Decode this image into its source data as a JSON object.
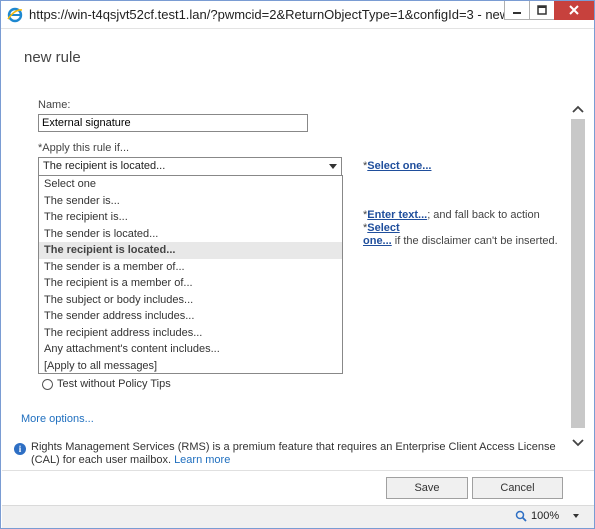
{
  "window": {
    "title": "https://win-t4qsjvt52cf.test1.lan/?pwmcid=2&ReturnObjectType=1&configId=3 - new r...",
    "close_color": "#c7413d"
  },
  "page": {
    "heading": "new rule"
  },
  "form": {
    "name_label": "Name:",
    "name_value": "External signature",
    "apply_label": "*Apply this rule if...",
    "apply_selected": "The recipient is located...",
    "dropdown_options": [
      "Select one",
      "The sender is...",
      "The recipient is...",
      "The sender is located...",
      "The recipient is located...",
      "The sender is a member of...",
      "The recipient is a member of...",
      "The subject or body includes...",
      "The sender address includes...",
      "The recipient address includes...",
      "Any attachment's content includes...",
      "[Apply to all messages]"
    ],
    "dropdown_selected_index": 4,
    "select_one_prefix": "*",
    "select_one_link": "Select one...",
    "action_prefix": "*",
    "enter_text_link": "Enter text...",
    "action_middle": "; and fall back to action *",
    "select_one_link2a": "Select",
    "select_one_link2b": "one...",
    "action_suffix": " if the disclaimer can't be inserted.",
    "radio_label": "Test without Policy Tips",
    "more_options": "More options..."
  },
  "info": {
    "text": "Rights Management Services (RMS) is a premium feature that requires an Enterprise Client Access License (CAL) for each user mailbox.",
    "link": "Learn more"
  },
  "buttons": {
    "save": "Save",
    "cancel": "Cancel"
  },
  "statusbar": {
    "zoom": "100%"
  },
  "colors": {
    "accent": "#1f6fbf",
    "link_bold": "#1f4e9c"
  }
}
